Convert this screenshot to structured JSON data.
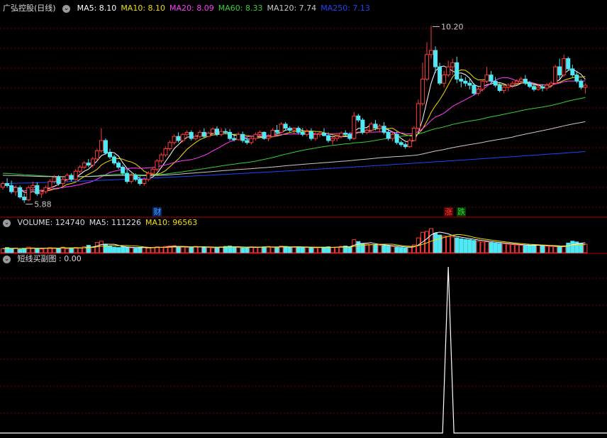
{
  "colors": {
    "up": "#ff3b3b",
    "down": "#4fe8f4",
    "ma5": "#ffffff",
    "ma10": "#f0e000",
    "ma20": "#ff3bff",
    "ma60": "#32d232",
    "ma120": "#c8c8c8",
    "ma250": "#1e46ff",
    "grid": "#7a0000",
    "divider": "#b00000",
    "bg": "#000000"
  },
  "price_panel": {
    "stock_name": "广弘控股(日线)",
    "ma_labels": [
      {
        "text": "MA5: 8.10",
        "color": "#ffffff"
      },
      {
        "text": "MA10: 8.10",
        "color": "#f0e000"
      },
      {
        "text": "MA20: 8.09",
        "color": "#ff3bff"
      },
      {
        "text": "MA60: 8.33",
        "color": "#32d232"
      },
      {
        "text": "MA120: 7.74",
        "color": "#c8c8c8"
      },
      {
        "text": "MA250: 7.13",
        "color": "#1e46ff"
      }
    ],
    "high_marker": "10.20",
    "low_marker": "5.88",
    "event_tags": [
      {
        "text": "财",
        "color": "#4fa0ff",
        "index": 36
      },
      {
        "text": "涨",
        "color": "#ff4040",
        "index": 104
      },
      {
        "text": "跌",
        "color": "#32d232",
        "index": 107
      }
    ]
  },
  "volume_panel": {
    "labels": [
      {
        "text": "VOLUME: 124740",
        "color": "#dddddd"
      },
      {
        "text": "MA5: 111226",
        "color": "#dddddd"
      },
      {
        "text": "MA10: 96563",
        "color": "#f0e000"
      }
    ]
  },
  "indicator_panel": {
    "labels": [
      {
        "text": "短线买副图 : 0.00",
        "color": "#dddddd"
      }
    ]
  },
  "chart_data": {
    "type": "candlestick",
    "title": "广弘控股(日线)",
    "ohlc": [
      [
        6.26,
        6.4,
        6.2,
        6.35
      ],
      [
        6.35,
        6.48,
        6.25,
        6.3
      ],
      [
        6.3,
        6.42,
        6.1,
        6.15
      ],
      [
        6.15,
        6.3,
        6.05,
        6.25
      ],
      [
        6.25,
        6.3,
        5.98,
        6.02
      ],
      [
        6.02,
        6.1,
        5.88,
        5.95
      ],
      [
        5.95,
        6.3,
        5.92,
        6.25
      ],
      [
        6.25,
        6.4,
        6.15,
        6.3
      ],
      [
        6.3,
        6.38,
        6.05,
        6.1
      ],
      [
        6.1,
        6.2,
        6.0,
        6.15
      ],
      [
        6.15,
        6.3,
        6.1,
        6.25
      ],
      [
        6.25,
        6.45,
        6.2,
        6.4
      ],
      [
        6.4,
        6.55,
        6.35,
        6.5
      ],
      [
        6.5,
        6.55,
        6.3,
        6.35
      ],
      [
        6.35,
        6.5,
        6.28,
        6.45
      ],
      [
        6.45,
        6.6,
        6.4,
        6.55
      ],
      [
        6.55,
        6.6,
        6.4,
        6.45
      ],
      [
        6.45,
        6.7,
        6.42,
        6.65
      ],
      [
        6.65,
        6.8,
        6.6,
        6.75
      ],
      [
        6.75,
        6.9,
        6.7,
        6.85
      ],
      [
        6.85,
        6.95,
        6.75,
        6.8
      ],
      [
        6.8,
        7.0,
        6.75,
        6.95
      ],
      [
        6.95,
        7.2,
        6.9,
        7.15
      ],
      [
        7.15,
        7.7,
        7.1,
        7.4
      ],
      [
        7.4,
        7.45,
        7.05,
        7.1
      ],
      [
        7.1,
        7.2,
        6.95,
        7.0
      ],
      [
        7.0,
        7.05,
        6.8,
        6.85
      ],
      [
        6.85,
        6.9,
        6.7,
        6.75
      ],
      [
        6.75,
        6.8,
        6.55,
        6.6
      ],
      [
        6.6,
        6.7,
        6.35,
        6.4
      ],
      [
        6.4,
        6.6,
        6.35,
        6.55
      ],
      [
        6.55,
        6.6,
        6.4,
        6.45
      ],
      [
        6.45,
        6.55,
        6.3,
        6.35
      ],
      [
        6.35,
        6.5,
        6.3,
        6.45
      ],
      [
        6.45,
        6.65,
        6.4,
        6.6
      ],
      [
        6.6,
        6.75,
        6.55,
        6.7
      ],
      [
        6.7,
        6.95,
        6.65,
        6.9
      ],
      [
        6.9,
        7.1,
        6.85,
        7.05
      ],
      [
        7.05,
        7.25,
        7.0,
        7.2
      ],
      [
        7.2,
        7.4,
        7.15,
        7.35
      ],
      [
        7.35,
        7.55,
        7.3,
        7.5
      ],
      [
        7.5,
        7.6,
        7.35,
        7.4
      ],
      [
        7.4,
        7.58,
        7.35,
        7.55
      ],
      [
        7.55,
        7.65,
        7.45,
        7.6
      ],
      [
        7.6,
        7.65,
        7.4,
        7.45
      ],
      [
        7.45,
        7.55,
        7.4,
        7.5
      ],
      [
        7.5,
        7.65,
        7.45,
        7.6
      ],
      [
        7.6,
        7.7,
        7.45,
        7.5
      ],
      [
        7.5,
        7.62,
        7.48,
        7.58
      ],
      [
        7.58,
        7.72,
        7.55,
        7.68
      ],
      [
        7.68,
        7.75,
        7.5,
        7.55
      ],
      [
        7.55,
        7.7,
        7.5,
        7.62
      ],
      [
        7.62,
        7.7,
        7.55,
        7.6
      ],
      [
        7.6,
        7.68,
        7.4,
        7.45
      ],
      [
        7.45,
        7.55,
        7.38,
        7.42
      ],
      [
        7.42,
        7.6,
        7.4,
        7.55
      ],
      [
        7.55,
        7.62,
        7.35,
        7.4
      ],
      [
        7.4,
        7.48,
        7.3,
        7.35
      ],
      [
        7.35,
        7.5,
        7.3,
        7.45
      ],
      [
        7.45,
        7.6,
        7.4,
        7.55
      ],
      [
        7.55,
        7.65,
        7.5,
        7.6
      ],
      [
        7.6,
        7.62,
        7.42,
        7.45
      ],
      [
        7.45,
        7.55,
        7.38,
        7.5
      ],
      [
        7.5,
        7.7,
        7.48,
        7.65
      ],
      [
        7.65,
        7.78,
        7.55,
        7.6
      ],
      [
        7.6,
        7.85,
        7.58,
        7.8
      ],
      [
        7.8,
        7.85,
        7.65,
        7.7
      ],
      [
        7.7,
        7.75,
        7.6,
        7.65
      ],
      [
        7.65,
        7.72,
        7.55,
        7.7
      ],
      [
        7.7,
        7.75,
        7.55,
        7.6
      ],
      [
        7.6,
        7.7,
        7.5,
        7.55
      ],
      [
        7.55,
        7.68,
        7.5,
        7.62
      ],
      [
        7.62,
        7.7,
        7.4,
        7.45
      ],
      [
        7.45,
        7.6,
        7.4,
        7.55
      ],
      [
        7.55,
        7.62,
        7.48,
        7.58
      ],
      [
        7.58,
        7.7,
        7.5,
        7.52
      ],
      [
        7.52,
        7.6,
        7.35,
        7.4
      ],
      [
        7.4,
        7.5,
        7.3,
        7.45
      ],
      [
        7.45,
        7.55,
        7.38,
        7.5
      ],
      [
        7.5,
        7.62,
        7.45,
        7.58
      ],
      [
        7.58,
        7.65,
        7.5,
        7.55
      ],
      [
        7.55,
        7.6,
        7.4,
        7.45
      ],
      [
        7.45,
        8.1,
        7.42,
        8.0
      ],
      [
        8.0,
        8.05,
        7.85,
        7.9
      ],
      [
        7.9,
        7.95,
        7.55,
        7.6
      ],
      [
        7.6,
        7.7,
        7.55,
        7.65
      ],
      [
        7.65,
        7.85,
        7.6,
        7.8
      ],
      [
        7.8,
        7.9,
        7.65,
        7.7
      ],
      [
        7.7,
        7.8,
        7.6,
        7.75
      ],
      [
        7.75,
        7.85,
        7.55,
        7.6
      ],
      [
        7.6,
        7.7,
        7.4,
        7.45
      ],
      [
        7.45,
        7.6,
        7.38,
        7.55
      ],
      [
        7.55,
        7.62,
        7.3,
        7.35
      ],
      [
        7.35,
        7.4,
        7.25,
        7.3
      ],
      [
        7.3,
        7.35,
        7.2,
        7.25
      ],
      [
        7.25,
        7.45,
        7.22,
        7.4
      ],
      [
        7.4,
        7.75,
        7.38,
        7.7
      ],
      [
        7.7,
        8.4,
        7.65,
        8.3
      ],
      [
        8.3,
        9.3,
        8.25,
        8.9
      ],
      [
        8.9,
        9.8,
        8.85,
        9.5
      ],
      [
        9.5,
        10.2,
        9.4,
        9.6
      ],
      [
        9.6,
        9.7,
        9.05,
        9.2
      ],
      [
        9.2,
        9.3,
        8.75,
        8.8
      ],
      [
        8.8,
        9.1,
        8.7,
        9.0
      ],
      [
        9.0,
        9.35,
        8.95,
        9.2
      ],
      [
        9.2,
        9.4,
        9.0,
        9.3
      ],
      [
        9.3,
        9.45,
        8.8,
        8.9
      ],
      [
        8.9,
        9.0,
        8.7,
        8.85
      ],
      [
        8.85,
        8.95,
        8.72,
        8.8
      ],
      [
        8.8,
        8.9,
        8.65,
        8.75
      ],
      [
        8.75,
        8.8,
        8.5,
        8.55
      ],
      [
        8.55,
        8.7,
        8.5,
        8.65
      ],
      [
        8.65,
        8.9,
        8.6,
        8.85
      ],
      [
        8.85,
        9.2,
        8.8,
        9.0
      ],
      [
        9.0,
        9.1,
        8.8,
        8.85
      ],
      [
        8.85,
        8.95,
        8.7,
        8.75
      ],
      [
        8.75,
        8.8,
        8.58,
        8.62
      ],
      [
        8.62,
        8.75,
        8.55,
        8.7
      ],
      [
        8.7,
        8.8,
        8.6,
        8.75
      ],
      [
        8.75,
        8.85,
        8.68,
        8.8
      ],
      [
        8.8,
        8.9,
        8.75,
        8.85
      ],
      [
        8.85,
        8.95,
        8.8,
        8.9
      ],
      [
        8.9,
        9.0,
        8.75,
        8.8
      ],
      [
        8.8,
        8.85,
        8.68,
        8.72
      ],
      [
        8.72,
        8.8,
        8.6,
        8.65
      ],
      [
        8.65,
        8.75,
        8.62,
        8.7
      ],
      [
        8.7,
        8.78,
        8.6,
        8.68
      ],
      [
        8.68,
        8.8,
        8.62,
        8.75
      ],
      [
        8.75,
        8.85,
        8.7,
        8.8
      ],
      [
        8.8,
        9.25,
        8.78,
        9.2
      ],
      [
        9.2,
        9.4,
        8.9,
        9.0
      ],
      [
        9.0,
        9.5,
        8.95,
        9.4
      ],
      [
        9.4,
        9.45,
        9.1,
        9.15
      ],
      [
        9.15,
        9.25,
        8.95,
        9.0
      ],
      [
        9.0,
        9.1,
        8.8,
        8.85
      ],
      [
        8.85,
        8.9,
        8.65,
        8.7
      ],
      [
        8.7,
        8.8,
        8.55,
        8.75
      ]
    ],
    "ma_latest": {
      "MA5": 8.1,
      "MA10": 8.1,
      "MA20": 8.09,
      "MA60": 8.33,
      "MA120": 7.74,
      "MA250": 7.13
    },
    "ma250_start": 6.35,
    "price_range": [
      5.7,
      10.45
    ],
    "volume": [
      22,
      28,
      20,
      25,
      18,
      24,
      30,
      26,
      22,
      20,
      25,
      28,
      26,
      24,
      30,
      22,
      26,
      28,
      25,
      32,
      40,
      30,
      55,
      62,
      45,
      35,
      30,
      28,
      32,
      30,
      26,
      24,
      28,
      30,
      26,
      28,
      32,
      30,
      34,
      36,
      38,
      32,
      30,
      28,
      30,
      34,
      32,
      30,
      28,
      26,
      30,
      32,
      34,
      36,
      30,
      28,
      26,
      30,
      32,
      28,
      30,
      32,
      34,
      30,
      28,
      36,
      34,
      30,
      28,
      32,
      30,
      28,
      30,
      26,
      28,
      30,
      32,
      28,
      30,
      34,
      36,
      32,
      70,
      60,
      50,
      46,
      44,
      42,
      40,
      38,
      36,
      34,
      30,
      28,
      26,
      30,
      42,
      80,
      110,
      115,
      130,
      105,
      95,
      90,
      88,
      85,
      80,
      75,
      72,
      70,
      66,
      62,
      58,
      60,
      55,
      52,
      50,
      48,
      46,
      44,
      42,
      40,
      38,
      40,
      42,
      40,
      38,
      36,
      34,
      32,
      30,
      36,
      52,
      62,
      58,
      50,
      46,
      44
    ],
    "volume_latest": {
      "VOLUME": 124740,
      "MA5": 111226,
      "MA10": 96563
    },
    "indicator_spike_index": 104,
    "indicator_latest": 0.0,
    "grid": true
  }
}
